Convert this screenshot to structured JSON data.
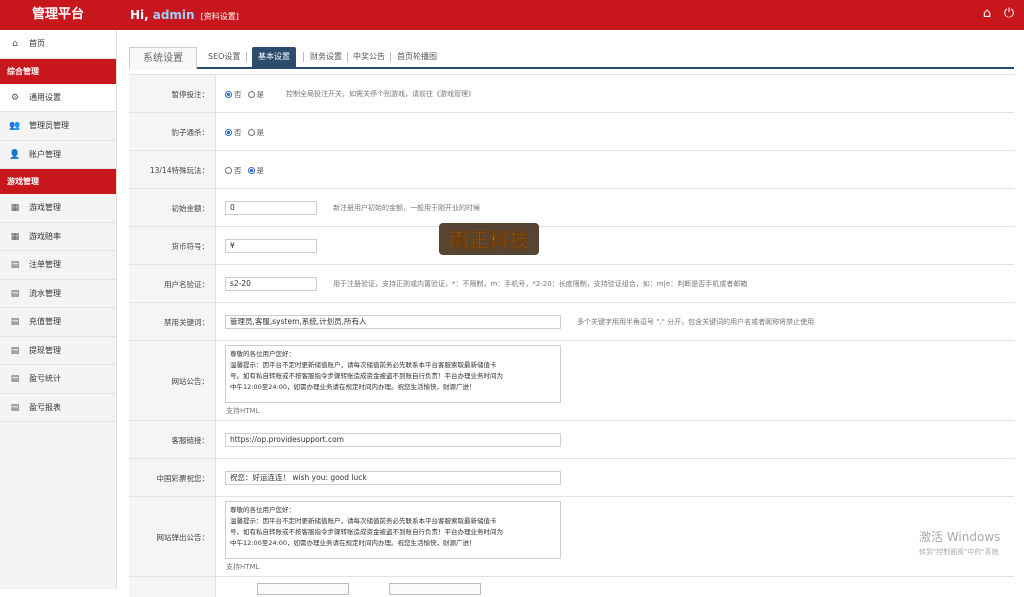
{
  "header": {
    "brand": "管理平台",
    "greeting": "Hi,",
    "username": "admin",
    "profile_link": "[资料设置]",
    "icons": [
      "home-icon",
      "power-icon"
    ],
    "color": "#c8161d"
  },
  "sidebar": {
    "items": [
      {
        "label": "首页",
        "icon": "home-icon",
        "type": "item",
        "active": true
      },
      {
        "label": "综合管理",
        "type": "group"
      },
      {
        "label": "通用设置",
        "icon": "gear-icon",
        "type": "item",
        "active": true
      },
      {
        "label": "管理员管理",
        "icon": "users-icon",
        "type": "item"
      },
      {
        "label": "账户管理",
        "icon": "user-icon",
        "type": "item"
      },
      {
        "label": "游戏管理",
        "type": "group"
      },
      {
        "label": "游戏管理",
        "icon": "grid-icon",
        "type": "item"
      },
      {
        "label": "游戏赔率",
        "icon": "grid-icon",
        "type": "item"
      },
      {
        "label": "注单管理",
        "icon": "doc-icon",
        "type": "item"
      },
      {
        "label": "流水管理",
        "icon": "doc-icon",
        "type": "item"
      },
      {
        "label": "充值管理",
        "icon": "doc-icon",
        "type": "item"
      },
      {
        "label": "提现管理",
        "icon": "doc-icon",
        "type": "item"
      },
      {
        "label": "盈亏统计",
        "icon": "doc-icon",
        "type": "item"
      },
      {
        "label": "盈亏报表",
        "icon": "doc-icon",
        "type": "item"
      }
    ]
  },
  "tabs": {
    "section_title": "系统设置",
    "items": [
      "SEO设置",
      "基本设置",
      "财务设置",
      "中奖公告",
      "首页轮播图"
    ],
    "active": "基本设置",
    "active_color": "#2d4b6e"
  },
  "form": {
    "pause_bet": {
      "label": "暂停投注：",
      "opt_no": "否",
      "opt_yes": "是",
      "selected": "no",
      "hint": "控制全局投注开关，如需关停个别游戏，请前往《游戏管理》"
    },
    "leopard": {
      "label": "豹子通杀：",
      "opt_no": "否",
      "opt_yes": "是",
      "selected": "no"
    },
    "special_1314": {
      "label": "13/14特殊玩法：",
      "opt_no": "否",
      "opt_yes": "是",
      "selected": "yes"
    },
    "init_amount": {
      "label": "初始金额：",
      "value": "0",
      "hint": "新注册用户初始的金额，一般用于刚开业的时候"
    },
    "currency": {
      "label": "货币符号：",
      "value": "¥"
    },
    "username_check": {
      "label": "用户名验证：",
      "value": "s2-20",
      "hint": "用于注册验证，支持正则或内置验证，*：不限制，m：手机号，*2-20：长度限制，支持验证组合，如：m|e：判断是否手机或者邮箱"
    },
    "banned_words": {
      "label": "禁用关键词：",
      "value": "管理员,客服,system,系统,计划员,所有人",
      "hint": "多个关键字用用半角逗号 \",\" 分开，包含关键词的用户名或者昵称将禁止使用"
    },
    "site_notice": {
      "label": "网站公告：",
      "lines": [
        "尊敬的各位用户您好：",
        "温馨提示：因平台不定时更新储值账户，请每次储值前务必先联系本平台客服索取最新储值卡",
        "号。如有私自转账或不按客服指令步骤转账造成资金被盗不到账自行负责！平台办理业务时间为",
        "中午12:00至24:00，如需办理业务请在规定时间内办理。祝您生活愉快，财源广进！"
      ],
      "note": "支持HTML"
    },
    "support_link": {
      "label": "客服链接：",
      "value": "https://op.providesupport.com"
    },
    "lottery_wish": {
      "label": "中国彩票祝您：",
      "value": "祝您：好运连连！ wish you: good luck"
    },
    "popup_notice": {
      "label": "网站弹出公告：",
      "lines": [
        "尊敬的各位用户您好：",
        "温馨提示：因平台不定时更新储值账户，请每次储值前务必先联系本平台客服索取最新储值卡",
        "号。如有私自转账或不按客服指令步骤转账造成资金被盗不到账自行负责！平台办理业务时间为",
        "中午12:00至24:00，如需办理业务请在规定时间内办理。祝您生活愉快，财源广进！"
      ],
      "note": "支持HTML"
    }
  },
  "logo_text": "南正科技",
  "watermark": {
    "line1": "激活 Windows",
    "line2": "转到\"控制面板\"中的\"系统"
  }
}
